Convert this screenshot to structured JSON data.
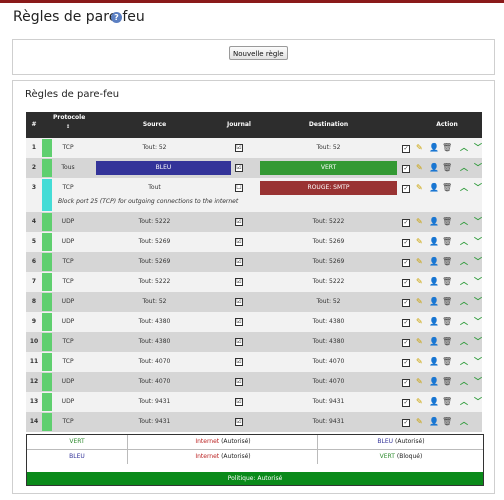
{
  "page": {
    "title": "Règles de pare-feu"
  },
  "toolbar": {
    "new_rule_label": "Nouvelle règle"
  },
  "section": {
    "title": "Règles de pare-feu"
  },
  "table": {
    "headers": {
      "num": "#",
      "protocol": "Protocole",
      "protocol_sort": "↕",
      "source": "Source",
      "journal": "Journal",
      "destination": "Destination",
      "action": "Action"
    },
    "rows": [
      {
        "num": "1",
        "protocol": "TCP",
        "source": "Tout: 52",
        "journal": "☑",
        "destination": "Tout: 52",
        "remark": "",
        "source_color": "",
        "dest_color": ""
      },
      {
        "num": "2",
        "protocol": "Tous",
        "source": "BLEU",
        "journal": "☑",
        "destination": "VERT",
        "remark": "",
        "source_color": "#333399",
        "dest_color": "#339933"
      },
      {
        "num": "3",
        "protocol": "TCP",
        "source": "Tout",
        "journal": "☐",
        "destination": "ROUGE: SMTP",
        "remark": "Block port 25 (TCP) for outgoing connections to the internet",
        "source_color": "",
        "dest_color": "#993333"
      },
      {
        "num": "4",
        "protocol": "UDP",
        "source": "Tout: 5222",
        "journal": "☑",
        "destination": "Tout: 5222",
        "remark": ""
      },
      {
        "num": "5",
        "protocol": "UDP",
        "source": "Tout: 5269",
        "journal": "☑",
        "destination": "Tout: 5269",
        "remark": ""
      },
      {
        "num": "6",
        "protocol": "TCP",
        "source": "Tout: 5269",
        "journal": "☑",
        "destination": "Tout: 5269",
        "remark": ""
      },
      {
        "num": "7",
        "protocol": "TCP",
        "source": "Tout: 5222",
        "journal": "☑",
        "destination": "Tout: 5222",
        "remark": ""
      },
      {
        "num": "8",
        "protocol": "UDP",
        "source": "Tout: 52",
        "journal": "☑",
        "destination": "Tout: 52",
        "remark": ""
      },
      {
        "num": "9",
        "protocol": "UDP",
        "source": "Tout: 4380",
        "journal": "☑",
        "destination": "Tout: 4380",
        "remark": ""
      },
      {
        "num": "10",
        "protocol": "TCP",
        "source": "Tout: 4380",
        "journal": "☑",
        "destination": "Tout: 4380",
        "remark": ""
      },
      {
        "num": "11",
        "protocol": "TCP",
        "source": "Tout: 4070",
        "journal": "☑",
        "destination": "Tout: 4070",
        "remark": ""
      },
      {
        "num": "12",
        "protocol": "UDP",
        "source": "Tout: 4070",
        "journal": "☑",
        "destination": "Tout: 4070",
        "remark": ""
      },
      {
        "num": "13",
        "protocol": "UDP",
        "source": "Tout: 9431",
        "journal": "☑",
        "destination": "Tout: 9431",
        "remark": ""
      },
      {
        "num": "14",
        "protocol": "TCP",
        "source": "Tout: 9431",
        "journal": "☑",
        "destination": "Tout: 9431",
        "remark": ""
      }
    ]
  },
  "policy": {
    "rows": [
      {
        "from": "VERT",
        "from_color": "#2e8b2e",
        "internet": "Internet",
        "internet_status": "(Autorisé)",
        "other": "BLEU",
        "other_color": "#333399",
        "other_status": "(Autorisé)"
      },
      {
        "from": "BLEU",
        "from_color": "#333399",
        "internet": "Internet",
        "internet_status": "(Autorisé)",
        "other": "VERT",
        "other_color": "#2e8b2e",
        "other_status": "(Bloqué)"
      }
    ],
    "footer": "Politique: Autorisé"
  },
  "icons": {
    "help": "help-icon",
    "checkbox": "checkbox-icon",
    "edit": "pencil-icon",
    "user": "user-edit-icon",
    "delete": "trash-icon",
    "up": "chevron-up-icon",
    "down": "chevron-down-icon"
  }
}
